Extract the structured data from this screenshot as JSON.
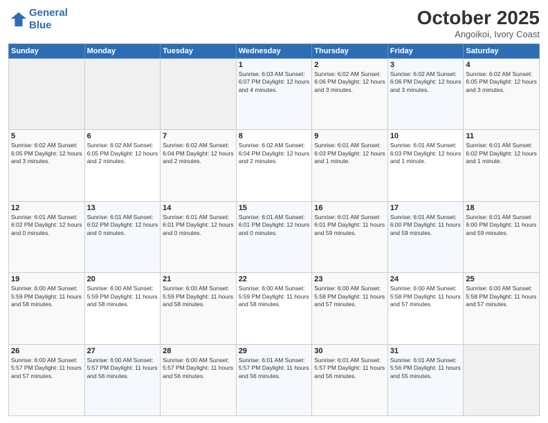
{
  "header": {
    "logo_line1": "General",
    "logo_line2": "Blue",
    "month": "October 2025",
    "location": "Angoikoi, Ivory Coast"
  },
  "days_of_week": [
    "Sunday",
    "Monday",
    "Tuesday",
    "Wednesday",
    "Thursday",
    "Friday",
    "Saturday"
  ],
  "weeks": [
    [
      {
        "num": "",
        "info": ""
      },
      {
        "num": "",
        "info": ""
      },
      {
        "num": "",
        "info": ""
      },
      {
        "num": "1",
        "info": "Sunrise: 6:03 AM\nSunset: 6:07 PM\nDaylight: 12 hours\nand 4 minutes."
      },
      {
        "num": "2",
        "info": "Sunrise: 6:02 AM\nSunset: 6:06 PM\nDaylight: 12 hours\nand 3 minutes."
      },
      {
        "num": "3",
        "info": "Sunrise: 6:02 AM\nSunset: 6:06 PM\nDaylight: 12 hours\nand 3 minutes."
      },
      {
        "num": "4",
        "info": "Sunrise: 6:02 AM\nSunset: 6:05 PM\nDaylight: 12 hours\nand 3 minutes."
      }
    ],
    [
      {
        "num": "5",
        "info": "Sunrise: 6:02 AM\nSunset: 6:05 PM\nDaylight: 12 hours\nand 3 minutes."
      },
      {
        "num": "6",
        "info": "Sunrise: 6:02 AM\nSunset: 6:05 PM\nDaylight: 12 hours\nand 2 minutes."
      },
      {
        "num": "7",
        "info": "Sunrise: 6:02 AM\nSunset: 6:04 PM\nDaylight: 12 hours\nand 2 minutes."
      },
      {
        "num": "8",
        "info": "Sunrise: 6:02 AM\nSunset: 6:04 PM\nDaylight: 12 hours\nand 2 minutes."
      },
      {
        "num": "9",
        "info": "Sunrise: 6:01 AM\nSunset: 6:03 PM\nDaylight: 12 hours\nand 1 minute."
      },
      {
        "num": "10",
        "info": "Sunrise: 6:01 AM\nSunset: 6:03 PM\nDaylight: 12 hours\nand 1 minute."
      },
      {
        "num": "11",
        "info": "Sunrise: 6:01 AM\nSunset: 6:02 PM\nDaylight: 12 hours\nand 1 minute."
      }
    ],
    [
      {
        "num": "12",
        "info": "Sunrise: 6:01 AM\nSunset: 6:02 PM\nDaylight: 12 hours\nand 0 minutes."
      },
      {
        "num": "13",
        "info": "Sunrise: 6:01 AM\nSunset: 6:02 PM\nDaylight: 12 hours\nand 0 minutes."
      },
      {
        "num": "14",
        "info": "Sunrise: 6:01 AM\nSunset: 6:01 PM\nDaylight: 12 hours\nand 0 minutes."
      },
      {
        "num": "15",
        "info": "Sunrise: 6:01 AM\nSunset: 6:01 PM\nDaylight: 12 hours\nand 0 minutes."
      },
      {
        "num": "16",
        "info": "Sunrise: 6:01 AM\nSunset: 6:01 PM\nDaylight: 11 hours\nand 59 minutes."
      },
      {
        "num": "17",
        "info": "Sunrise: 6:01 AM\nSunset: 6:00 PM\nDaylight: 11 hours\nand 59 minutes."
      },
      {
        "num": "18",
        "info": "Sunrise: 6:01 AM\nSunset: 6:00 PM\nDaylight: 11 hours\nand 59 minutes."
      }
    ],
    [
      {
        "num": "19",
        "info": "Sunrise: 6:00 AM\nSunset: 5:59 PM\nDaylight: 11 hours\nand 58 minutes."
      },
      {
        "num": "20",
        "info": "Sunrise: 6:00 AM\nSunset: 5:59 PM\nDaylight: 11 hours\nand 58 minutes."
      },
      {
        "num": "21",
        "info": "Sunrise: 6:00 AM\nSunset: 5:59 PM\nDaylight: 11 hours\nand 58 minutes."
      },
      {
        "num": "22",
        "info": "Sunrise: 6:00 AM\nSunset: 5:59 PM\nDaylight: 11 hours\nand 58 minutes."
      },
      {
        "num": "23",
        "info": "Sunrise: 6:00 AM\nSunset: 5:58 PM\nDaylight: 11 hours\nand 57 minutes."
      },
      {
        "num": "24",
        "info": "Sunrise: 6:00 AM\nSunset: 5:58 PM\nDaylight: 11 hours\nand 57 minutes."
      },
      {
        "num": "25",
        "info": "Sunrise: 6:00 AM\nSunset: 5:58 PM\nDaylight: 11 hours\nand 57 minutes."
      }
    ],
    [
      {
        "num": "26",
        "info": "Sunrise: 6:00 AM\nSunset: 5:57 PM\nDaylight: 11 hours\nand 57 minutes."
      },
      {
        "num": "27",
        "info": "Sunrise: 6:00 AM\nSunset: 5:57 PM\nDaylight: 11 hours\nand 56 minutes."
      },
      {
        "num": "28",
        "info": "Sunrise: 6:00 AM\nSunset: 5:57 PM\nDaylight: 11 hours\nand 56 minutes."
      },
      {
        "num": "29",
        "info": "Sunrise: 6:01 AM\nSunset: 5:57 PM\nDaylight: 11 hours\nand 56 minutes."
      },
      {
        "num": "30",
        "info": "Sunrise: 6:01 AM\nSunset: 5:57 PM\nDaylight: 11 hours\nand 56 minutes."
      },
      {
        "num": "31",
        "info": "Sunrise: 6:01 AM\nSunset: 5:56 PM\nDaylight: 11 hours\nand 55 minutes."
      },
      {
        "num": "",
        "info": ""
      }
    ]
  ]
}
